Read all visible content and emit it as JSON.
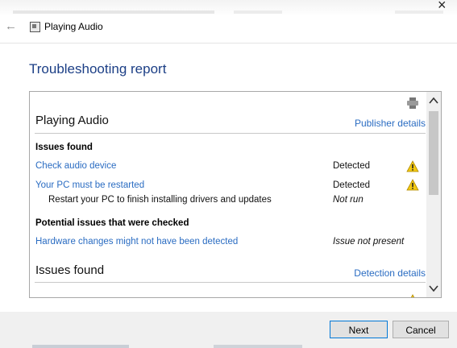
{
  "window": {
    "title": "Playing Audio",
    "close_glyph": "×",
    "back_glyph": "←"
  },
  "page": {
    "heading": "Troubleshooting report"
  },
  "report": {
    "section1": {
      "title": "Playing Audio",
      "link": "Publisher details"
    },
    "issues_found_label": "Issues found",
    "issues": [
      {
        "name": "Check audio device",
        "status": "Detected",
        "icon": "warning-icon"
      },
      {
        "name": "Your PC must be restarted",
        "status": "Detected",
        "icon": "warning-icon"
      }
    ],
    "sub_issue": {
      "text": "Restart your PC to finish installing drivers and updates",
      "status": "Not run"
    },
    "potential_label": "Potential issues that were checked",
    "potential": [
      {
        "name": "Hardware changes might not have been detected",
        "status": "Issue not present"
      }
    ],
    "section2": {
      "title": "Issues found",
      "link": "Detection details"
    }
  },
  "buttons": {
    "next": "Next",
    "cancel": "Cancel"
  },
  "colors": {
    "heading": "#1c3f86",
    "link": "#2a6cc2",
    "warning": "#f2c811",
    "footer": "#f0f0f0"
  }
}
